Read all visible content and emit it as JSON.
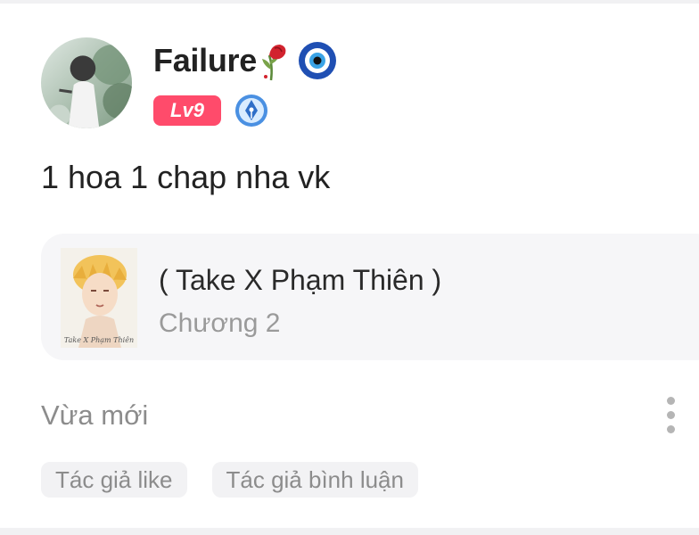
{
  "comment": {
    "username": "Failure",
    "username_emojis": [
      "wilted-rose-icon",
      "nazar-amulet-icon"
    ],
    "level_label": "Lv9",
    "text": "1 hoa 1 chap nha vk"
  },
  "story": {
    "title": "( Take X Phạm Thiên )",
    "chapter": "Chương 2",
    "cover_caption": "Take X Phạm Thiên"
  },
  "meta": {
    "timestamp": "Vừa mới"
  },
  "tags": [
    {
      "label": "Tác giả like"
    },
    {
      "label": "Tác giả bình luận"
    }
  ],
  "colors": {
    "level_badge": "#ff4b6b",
    "card_bg": "#f6f6f8",
    "muted_text": "#8c8c8c"
  }
}
